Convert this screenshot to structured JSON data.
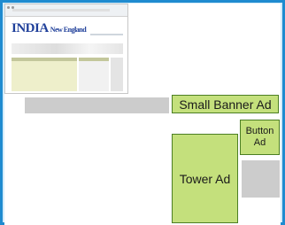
{
  "ads": {
    "small_banner": "Small Banner Ad",
    "button": "Button Ad",
    "tower": "Tower Ad"
  },
  "thumbnail": {
    "logo_main": "INDIA",
    "logo_sub": "New England"
  },
  "colors": {
    "frame_border": "#1f8bd0",
    "frame_fill": "#d4ecfa",
    "ad_fill": "#c4e07c",
    "ad_border": "#4c7f24",
    "placeholder_gray": "#cccccc"
  }
}
